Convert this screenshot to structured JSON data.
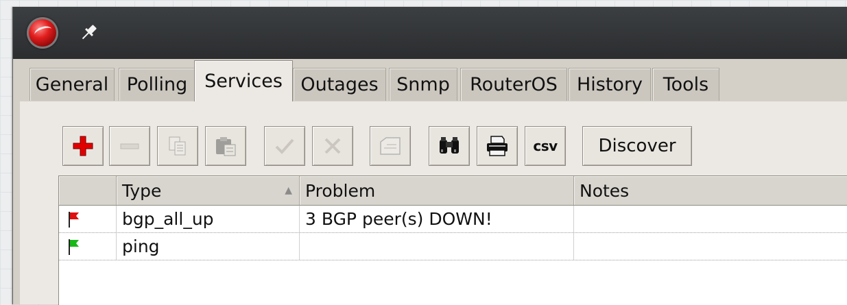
{
  "tabs": [
    {
      "label": "General"
    },
    {
      "label": "Polling"
    },
    {
      "label": "Services",
      "active": true
    },
    {
      "label": "Outages"
    },
    {
      "label": "Snmp"
    },
    {
      "label": "RouterOS"
    },
    {
      "label": "History"
    },
    {
      "label": "Tools"
    }
  ],
  "toolbar": {
    "add_icon": "plus-icon",
    "remove_icon": "minus-icon",
    "copy_icon": "copy-icon",
    "paste_icon": "paste-icon",
    "enable_icon": "check-icon",
    "disable_icon": "cross-icon",
    "comment_icon": "comment-icon",
    "find_icon": "binoculars-icon",
    "print_icon": "printer-icon",
    "csv_label": "csv",
    "discover_label": "Discover"
  },
  "table": {
    "columns": [
      {
        "label": ""
      },
      {
        "label": "Type",
        "sorted": "ascending"
      },
      {
        "label": "Problem"
      },
      {
        "label": "Notes"
      }
    ],
    "rows": [
      {
        "flag": "red",
        "type": "bgp_all_up",
        "problem": "3 BGP peer(s) DOWN!",
        "notes": ""
      },
      {
        "flag": "green",
        "type": "ping",
        "problem": "",
        "notes": ""
      }
    ]
  },
  "colors": {
    "flag_down": "#e01010",
    "flag_up": "#18b818",
    "add_icon": "#e00000",
    "titlebar": "#2f3234"
  }
}
